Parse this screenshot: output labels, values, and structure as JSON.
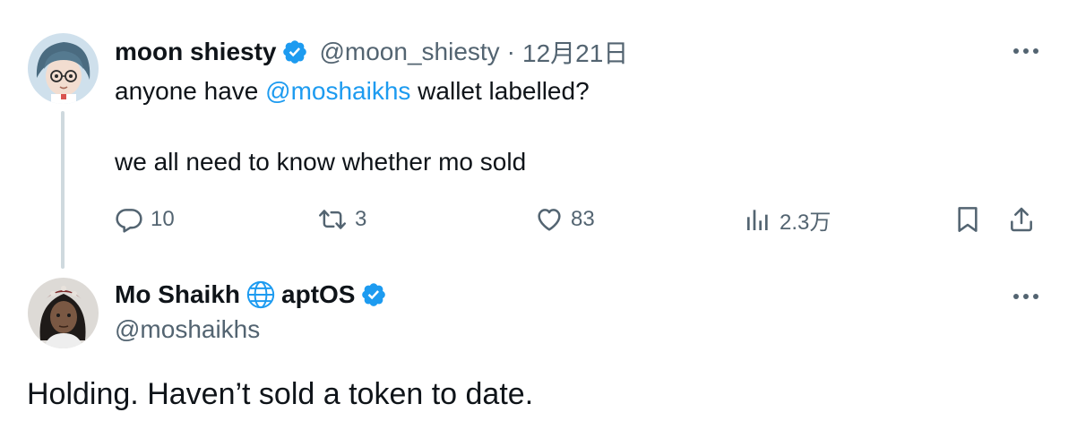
{
  "tweet1": {
    "display_name": "moon shiesty",
    "handle": "@moon_shiesty",
    "separator": "·",
    "date": "12月21日",
    "text_prefix": "anyone have ",
    "mention": "@moshaikhs",
    "text_suffix": " wallet labelled?",
    "text_line2": "we all need to know whether mo sold",
    "actions": {
      "reply_count": "10",
      "retweet_count": "3",
      "like_count": "83",
      "views_count": "2.3万"
    }
  },
  "tweet2": {
    "display_name": "Mo Shaikh",
    "name_suffix": "aptOS",
    "handle": "@moshaikhs",
    "text": "Holding. Haven’t sold a token to date."
  },
  "colors": {
    "text": "#0f1419",
    "secondary": "#536471",
    "link": "#1d9bf0",
    "verified": "#1d9bf0",
    "thread_line": "#cfd9de"
  },
  "icons": {
    "verified": "verified-badge-icon",
    "more": "more-dots-icon",
    "reply": "reply-icon",
    "retweet": "retweet-icon",
    "like": "heart-icon",
    "views": "views-icon",
    "bookmark": "bookmark-icon",
    "share": "share-icon",
    "globe": "globe-icon"
  }
}
